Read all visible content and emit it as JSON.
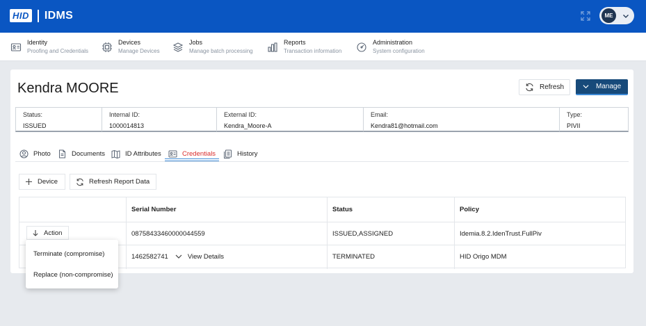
{
  "header": {
    "logo_brand": "HID",
    "app_name": "IDMS",
    "user_initials": "ME"
  },
  "nav": [
    {
      "title": "Identity",
      "subtitle": "Proofing and Credentials",
      "icon": "id-card-icon"
    },
    {
      "title": "Devices",
      "subtitle": "Manage Devices",
      "icon": "chip-icon"
    },
    {
      "title": "Jobs",
      "subtitle": "Manage batch processing",
      "icon": "layers-icon"
    },
    {
      "title": "Reports",
      "subtitle": "Transaction information",
      "icon": "bar-chart-icon"
    },
    {
      "title": "Administration",
      "subtitle": "System configuration",
      "icon": "gauge-icon"
    }
  ],
  "person": {
    "name": "Kendra MOORE"
  },
  "actions": {
    "refresh_label": "Refresh",
    "manage_label": "Manage"
  },
  "info": [
    {
      "label": "Status:",
      "value": "ISSUED"
    },
    {
      "label": "Internal ID:",
      "value": "1000014813"
    },
    {
      "label": "External ID:",
      "value": "Kendra_Moore-A"
    },
    {
      "label": "Email:",
      "value": "Kendra81@hotmail.com"
    },
    {
      "label": "Type:",
      "value": "PIVII"
    }
  ],
  "tabs": [
    {
      "label": "Photo"
    },
    {
      "label": "Documents"
    },
    {
      "label": "ID Attributes"
    },
    {
      "label": "Credentials"
    },
    {
      "label": "History"
    }
  ],
  "toolbar": {
    "device_label": "Device",
    "refresh_report_label": "Refresh Report Data"
  },
  "table": {
    "headers": [
      "Serial Number",
      "Status",
      "Policy"
    ],
    "rows": [
      {
        "serial": "08758433460000044559",
        "status": "ISSUED,ASSIGNED",
        "policy": "Idemia.8.2.IdenTrust.FullPiv"
      },
      {
        "serial": "1462582741",
        "status": "TERMINATED",
        "policy": "HID Origo MDM"
      }
    ],
    "action_label": "Action",
    "view_details_label": "View Details"
  },
  "dropdown": {
    "items": [
      "Terminate (compromise)",
      "Replace (non-compromise)"
    ]
  },
  "colors": {
    "header_bg": "#0a56c2",
    "manage_bg": "#174a7a",
    "active_tab": "#d92b2b",
    "accent": "#3d8ad6"
  }
}
